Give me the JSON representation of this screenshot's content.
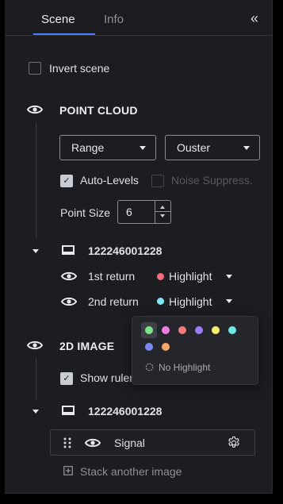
{
  "tabs": {
    "scene": "Scene",
    "info": "Info",
    "collapse_glyph": "«"
  },
  "invert_scene": {
    "label": "Invert scene",
    "checked": false
  },
  "point_cloud": {
    "title": "POINT CLOUD",
    "color_mode": "Range",
    "colormap": "Ouster",
    "auto_levels": {
      "label": "Auto-Levels",
      "checked": true
    },
    "noise_suppress": {
      "label": "Noise Suppress.",
      "checked": false,
      "disabled": true
    },
    "point_size": {
      "label": "Point Size",
      "value": "6"
    },
    "sensor": {
      "id": "122246001228",
      "returns": [
        {
          "label": "1st return",
          "highlight": "Highlight",
          "color": "#f26d7d"
        },
        {
          "label": "2nd return",
          "highlight": "Highlight",
          "color": "#7fe6f5"
        }
      ]
    }
  },
  "highlight_popup": {
    "colors": [
      "#7ee58a",
      "#f07ce2",
      "#f47a7a",
      "#9b7cf5",
      "#f5ee6a",
      "#6fe8e8",
      "#7b88f0",
      "#f5a76a"
    ],
    "selected_index": 0,
    "no_highlight": "No Highlight"
  },
  "image_2d": {
    "title": "2D IMAGE",
    "show_rulers": {
      "label": "Show rulers",
      "checked": true
    },
    "sensor": {
      "id": "122246001228"
    },
    "layer": {
      "label": "Signal"
    },
    "stack_another": "Stack another image"
  }
}
